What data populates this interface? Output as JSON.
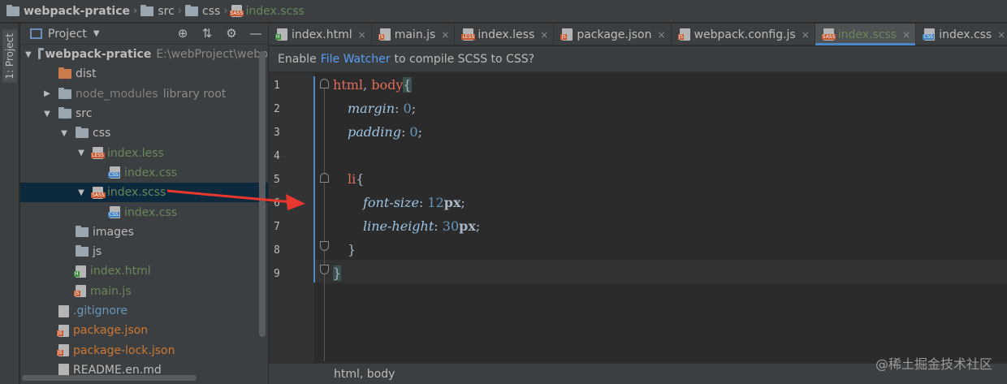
{
  "breadcrumb": {
    "items": [
      "webpack-pratice",
      "src",
      "css",
      "index.scss"
    ]
  },
  "left_strip": {
    "label": "1: Project"
  },
  "project": {
    "title": "Project",
    "tree": [
      {
        "label": "webpack-pratice",
        "hint": "E:\\webProject\\webp",
        "depth": 0,
        "arrow": "down",
        "icon": "folder",
        "color": "default",
        "bold": true
      },
      {
        "label": "dist",
        "depth": 1,
        "arrow": "none",
        "icon": "folder-orange",
        "color": "default"
      },
      {
        "label": "node_modules",
        "hint": "library root",
        "depth": 1,
        "arrow": "right",
        "icon": "folder",
        "color": "grey"
      },
      {
        "label": "src",
        "depth": 1,
        "arrow": "down",
        "icon": "folder",
        "color": "default"
      },
      {
        "label": "css",
        "depth": 2,
        "arrow": "down",
        "icon": "folder",
        "color": "default"
      },
      {
        "label": "index.less",
        "depth": 3,
        "arrow": "down",
        "icon": "less",
        "color": "green"
      },
      {
        "label": "index.css",
        "depth": 4,
        "arrow": "none",
        "icon": "css",
        "color": "green"
      },
      {
        "label": "index.scss",
        "depth": 3,
        "arrow": "down",
        "icon": "scss",
        "color": "green",
        "selected": true
      },
      {
        "label": "index.css",
        "depth": 4,
        "arrow": "none",
        "icon": "css",
        "color": "green"
      },
      {
        "label": "images",
        "depth": 2,
        "arrow": "none",
        "icon": "folder",
        "color": "default"
      },
      {
        "label": "js",
        "depth": 2,
        "arrow": "none",
        "icon": "folder",
        "color": "default"
      },
      {
        "label": "index.html",
        "depth": 2,
        "arrow": "none",
        "icon": "html",
        "color": "green"
      },
      {
        "label": "main.js",
        "depth": 2,
        "arrow": "none",
        "icon": "js",
        "color": "green"
      },
      {
        "label": ".gitignore",
        "depth": 1,
        "arrow": "none",
        "icon": "file",
        "color": "blue"
      },
      {
        "label": "package.json",
        "depth": 1,
        "arrow": "none",
        "icon": "json",
        "color": "orange"
      },
      {
        "label": "package-lock.json",
        "depth": 1,
        "arrow": "none",
        "icon": "json",
        "color": "orange"
      },
      {
        "label": "README.en.md",
        "depth": 1,
        "arrow": "none",
        "icon": "md",
        "color": "default"
      }
    ]
  },
  "tabs": [
    {
      "label": "index.html",
      "icon": "html",
      "active": false
    },
    {
      "label": "main.js",
      "icon": "js",
      "active": false
    },
    {
      "label": "index.less",
      "icon": "less",
      "active": false
    },
    {
      "label": "package.json",
      "icon": "json",
      "active": false
    },
    {
      "label": "webpack.config.js",
      "icon": "js",
      "active": false
    },
    {
      "label": "index.scss",
      "icon": "scss",
      "active": true
    },
    {
      "label": "index.css",
      "icon": "css",
      "active": false
    }
  ],
  "notification": {
    "before": "Enable",
    "link": "File Watcher",
    "after": "to compile SCSS to CSS?"
  },
  "editor": {
    "line_numbers": [
      "1",
      "2",
      "3",
      "4",
      "5",
      "6",
      "7",
      "8",
      "9"
    ],
    "code": {
      "l1_sel1": "html",
      "l1_comma": ", ",
      "l1_sel2": "body",
      "l1_brace": "{",
      "l2_prop": "margin",
      "l2_val": "0",
      "l3_prop": "padding",
      "l3_val": "0",
      "l5_sel": "li",
      "l5_brace": "{",
      "l6_prop": "font-size",
      "l6_num": "12",
      "l6_unit": "px",
      "l7_prop": "line-height",
      "l7_num": "30",
      "l7_unit": "px",
      "l8_brace": "}",
      "l9_brace": "}",
      "colon": ": ",
      "semi": ";"
    }
  },
  "status": {
    "breadcrumb": "html, body"
  },
  "watermark": "@稀土掘金技术社区",
  "colors": {
    "accent": "#4a88c7",
    "link": "#589df6",
    "green_file": "#6a8759",
    "orange_file": "#cc7832",
    "annotation_arrow": "#e8382e"
  }
}
